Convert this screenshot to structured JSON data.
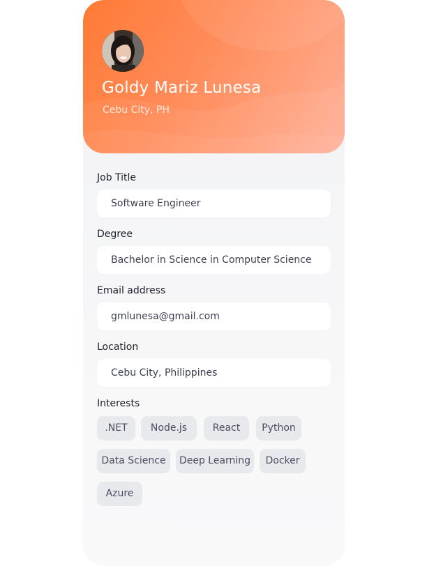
{
  "profile": {
    "name": "Goldy Mariz Lunesa",
    "city": "Cebu City, PH",
    "header_gradient": [
      "#ff7a35",
      "#ffb09a"
    ]
  },
  "fields": {
    "job_title": {
      "label": "Job Title",
      "value": "Software Engineer"
    },
    "degree": {
      "label": "Degree",
      "value": "Bachelor in Science in Computer Science"
    },
    "email": {
      "label": "Email address",
      "value": "gmlunesa@gmail.com"
    },
    "location": {
      "label": "Location",
      "value": "Cebu City, Philippines"
    }
  },
  "interests": {
    "label": "Interests",
    "items": [
      ".NET",
      "Node.js",
      "React",
      "Python",
      "Data Science",
      "Deep Learning",
      "Docker",
      "Azure"
    ]
  }
}
